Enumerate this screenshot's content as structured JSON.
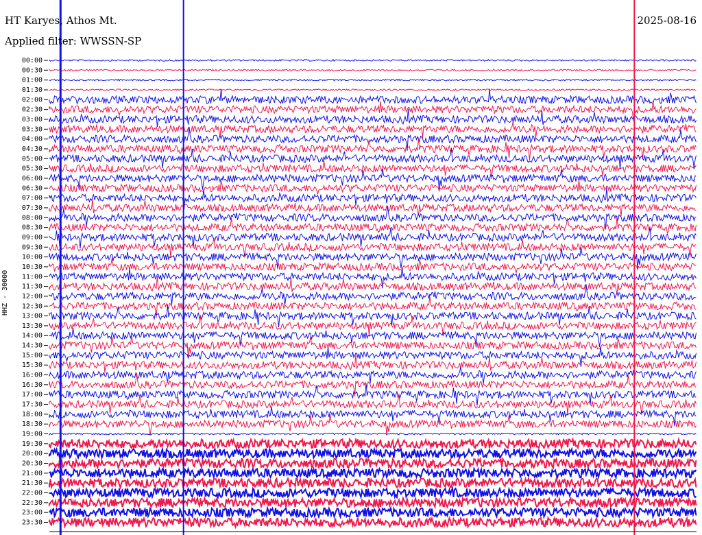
{
  "header": {
    "station": "HT Karyes, Athos Mt.",
    "filter": "Applied filter: WWSSN-SP",
    "date": "2025-08-16",
    "side_label": "HHZ - 30000"
  },
  "colors": {
    "blue": "#1010e6",
    "red": "#f0184c",
    "axis": "#000000"
  },
  "chart_data": {
    "type": "line",
    "title": "HT Karyes, Athos Mt.",
    "subtitle": "Applied filter: WWSSN-SP",
    "ylabel": "HHZ - 30000",
    "y_tick_labels": [
      "00:00",
      "00:30",
      "01:00",
      "01:30",
      "02:00",
      "02:30",
      "03:00",
      "03:30",
      "04:00",
      "04:30",
      "05:00",
      "05:30",
      "06:00",
      "06:30",
      "07:00",
      "07:30",
      "08:00",
      "08:30",
      "09:00",
      "09:30",
      "10:00",
      "10:30",
      "11:00",
      "11:30",
      "12:00",
      "12:30",
      "13:00",
      "13:30",
      "14:00",
      "14:30",
      "15:00",
      "15:30",
      "16:00",
      "16:30",
      "17:00",
      "17:30",
      "18:00",
      "18:30",
      "19:00",
      "19:30",
      "20:00",
      "20:30",
      "21:00",
      "21:30",
      "22:00",
      "22:30",
      "23:00",
      "23:30"
    ],
    "row_colors": [
      "blue",
      "red"
    ],
    "event_minutes": [
      0.2,
      5.9,
      26.8
    ],
    "busy_rows": [
      4,
      5,
      6,
      7,
      8,
      9,
      10,
      11,
      12,
      13,
      14,
      15,
      16,
      17,
      18,
      19,
      20,
      21,
      22,
      23,
      24,
      25,
      26,
      27,
      28,
      29,
      30,
      31,
      32,
      33,
      34,
      35,
      36,
      37
    ],
    "noisy_rows": [
      39,
      40,
      41,
      42,
      43,
      44,
      45,
      46,
      47
    ]
  }
}
